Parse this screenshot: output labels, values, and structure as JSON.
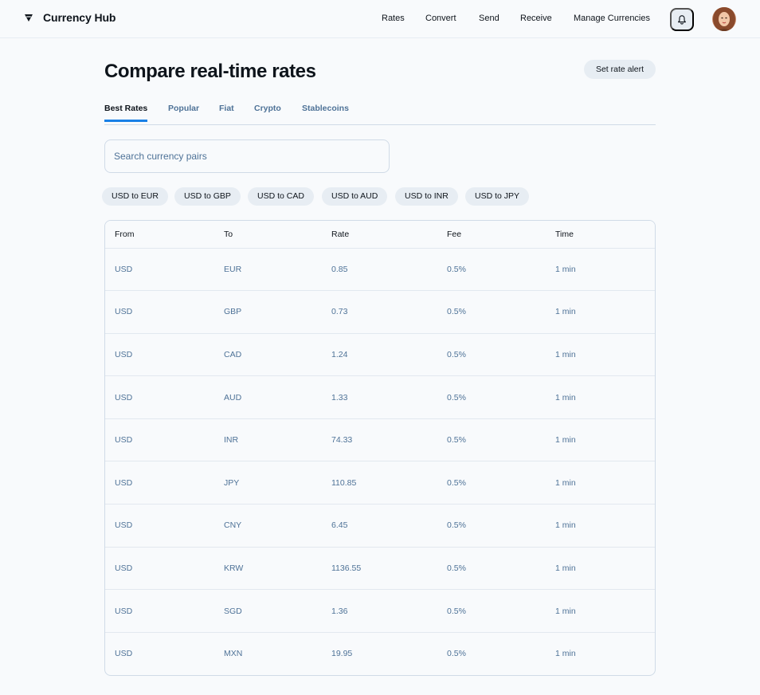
{
  "header": {
    "brand": "Currency Hub",
    "brand_icon": "triangle-logo-icon",
    "nav": [
      "Rates",
      "Convert",
      "Send",
      "Receive",
      "Manage Currencies"
    ],
    "bell_icon": "bell-icon",
    "avatar_icon": "user-avatar"
  },
  "main": {
    "title": "Compare real-time rates",
    "alert_button": "Set rate alert",
    "tabs": [
      "Best Rates",
      "Popular",
      "Fiat",
      "Crypto",
      "Stablecoins"
    ],
    "active_tab": "Best Rates",
    "search": {
      "placeholder": "Search currency pairs",
      "value": ""
    },
    "chips": [
      "USD to EUR",
      "USD to GBP",
      "USD to CAD",
      "USD to AUD",
      "USD to INR",
      "USD to JPY"
    ]
  },
  "table": {
    "headers": [
      "From",
      "To",
      "Rate",
      "Fee",
      "Time"
    ],
    "rows": [
      [
        "USD",
        "EUR",
        "0.85",
        "0.5%",
        "1 min"
      ],
      [
        "USD",
        "GBP",
        "0.73",
        "0.5%",
        "1 min"
      ],
      [
        "USD",
        "CAD",
        "1.24",
        "0.5%",
        "1 min"
      ],
      [
        "USD",
        "AUD",
        "1.33",
        "0.5%",
        "1 min"
      ],
      [
        "USD",
        "INR",
        "74.33",
        "0.5%",
        "1 min"
      ],
      [
        "USD",
        "JPY",
        "110.85",
        "0.5%",
        "1 min"
      ],
      [
        "USD",
        "CNY",
        "6.45",
        "0.5%",
        "1 min"
      ],
      [
        "USD",
        "KRW",
        "1136.55",
        "0.5%",
        "1 min"
      ],
      [
        "USD",
        "SGD",
        "1.36",
        "0.5%",
        "1 min"
      ],
      [
        "USD",
        "MXN",
        "19.95",
        "0.5%",
        "1 min"
      ]
    ]
  },
  "colors": {
    "accent": "#1980e6",
    "muted_text": "#4e7297",
    "chip_bg": "#e7edf3",
    "border": "#d0dbe7"
  }
}
